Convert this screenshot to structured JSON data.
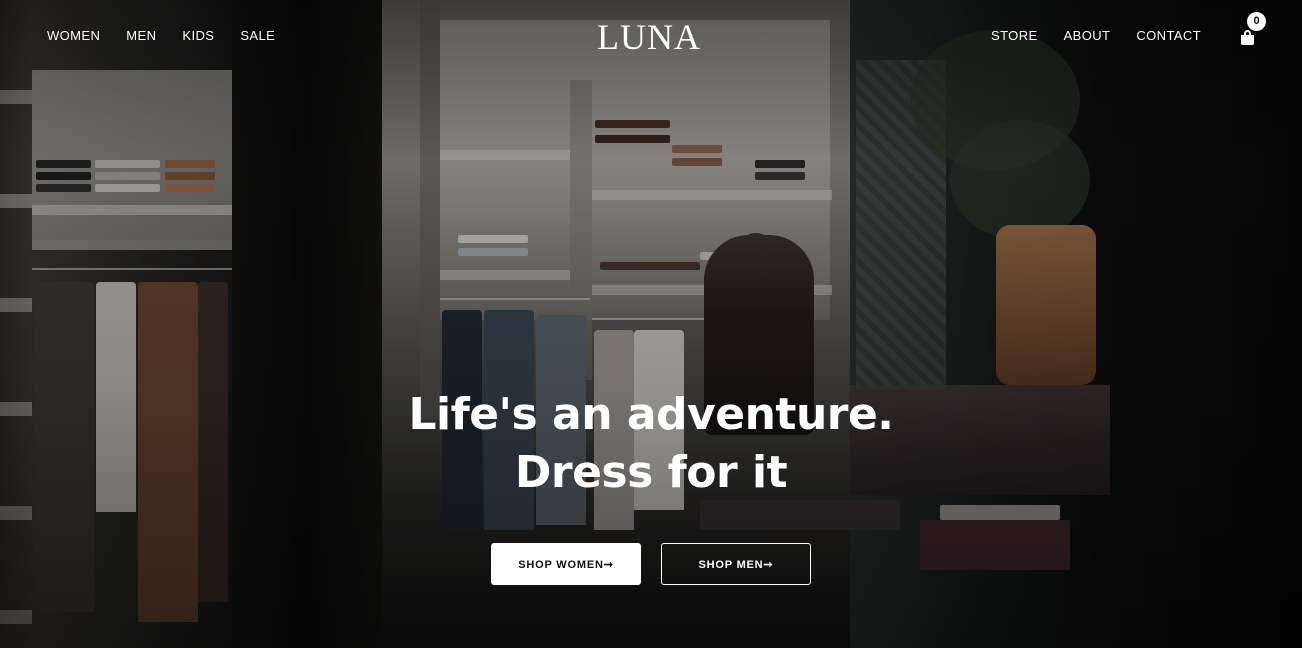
{
  "nav": {
    "left": [
      "WOMEN",
      "MEN",
      "KIDS",
      "SALE"
    ],
    "right": [
      "STORE",
      "ABOUT",
      "CONTACT"
    ],
    "logo": "LUNA",
    "cart_count": "0",
    "cart_icon": "shopping-bag-icon"
  },
  "hero": {
    "headline_line1": "Life's an adventure.",
    "headline_line2": "Dress for it",
    "shop_women": "SHOP WOMEN➞",
    "shop_men": "SHOP MEN➞"
  },
  "colors": {
    "text": "#ffffff",
    "button_primary_bg": "#ffffff",
    "button_primary_text": "#111111",
    "overlay": "#000000"
  }
}
